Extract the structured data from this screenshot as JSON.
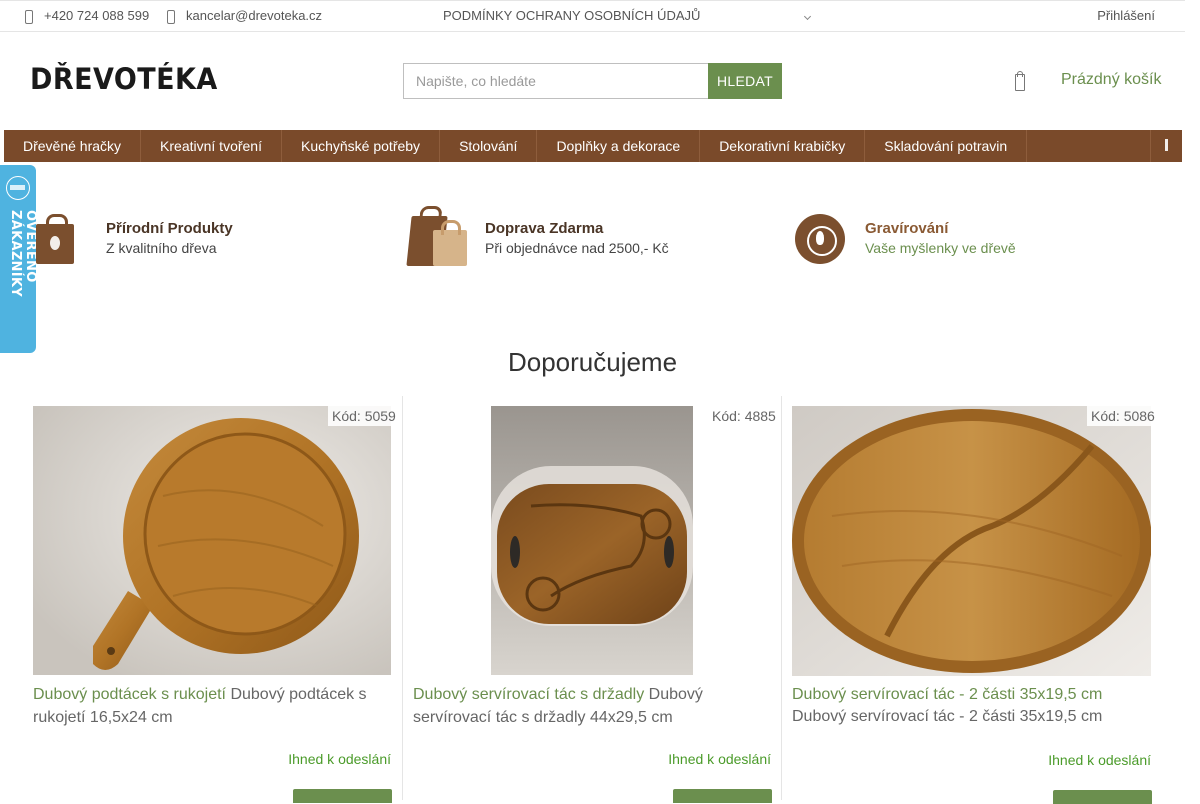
{
  "topbar": {
    "phone": "+420 724 088 599",
    "email": "kancelar@drevoteka.cz",
    "privacy_link": "PODMÍNKY OCHRANY OSOBNÍCH ÚDAJŮ",
    "login": "Přihlášení"
  },
  "header": {
    "logo_text": "DŘEVOTÉKA",
    "search_placeholder": "Napište, co hledáte",
    "search_button": "HLEDAT",
    "cart_label": "Prázdný košík"
  },
  "nav": {
    "items": [
      "Dřevěné hračky",
      "Kreativní tvoření",
      "Kuchyňské potřeby",
      "Stolování",
      "Doplňky a dekorace",
      "Dekorativní krabičky",
      "Skladování potravin"
    ]
  },
  "verified_badge": {
    "text": "OVĚŘENO ZÁKAZNÍKY"
  },
  "usp": [
    {
      "title": "Přírodní Produkty",
      "subtitle": "Z kvalitního dřeva",
      "icon": "bag-leaf-icon"
    },
    {
      "title": "Doprava Zdarma",
      "subtitle": "Při objednávce nad 2500,- Kč",
      "icon": "shopping-bags-icon"
    },
    {
      "title": "Gravírování",
      "subtitle": "Vaše myšlenky ve dřevě",
      "icon": "engraving-leaf-icon"
    }
  ],
  "section": {
    "title": "Doporučujeme"
  },
  "products": [
    {
      "code": "Kód: 5059",
      "link": "Dubový podtácek s rukojetí",
      "description": "Dubový podtácek s rukojetí 16,5x24 cm",
      "availability": "Ihned k odeslání"
    },
    {
      "code": "Kód: 4885",
      "link": "Dubový servírovací tác s držadly",
      "description": "Dubový servírovací tác s držadly 44x29,5 cm",
      "availability": "Ihned k odeslání"
    },
    {
      "code": "Kód: 5086",
      "link": "Dubový servírovací tác - 2 části 35x19,5 cm",
      "description": "Dubový servírovací tác - 2 části 35x19,5 cm",
      "availability": "Ihned k odeslání"
    }
  ],
  "colors": {
    "accent_green": "#6b8f4e",
    "nav_brown": "#7a4a2a",
    "badge_blue": "#4fb3e0",
    "availability_green": "#4b9b2a"
  }
}
